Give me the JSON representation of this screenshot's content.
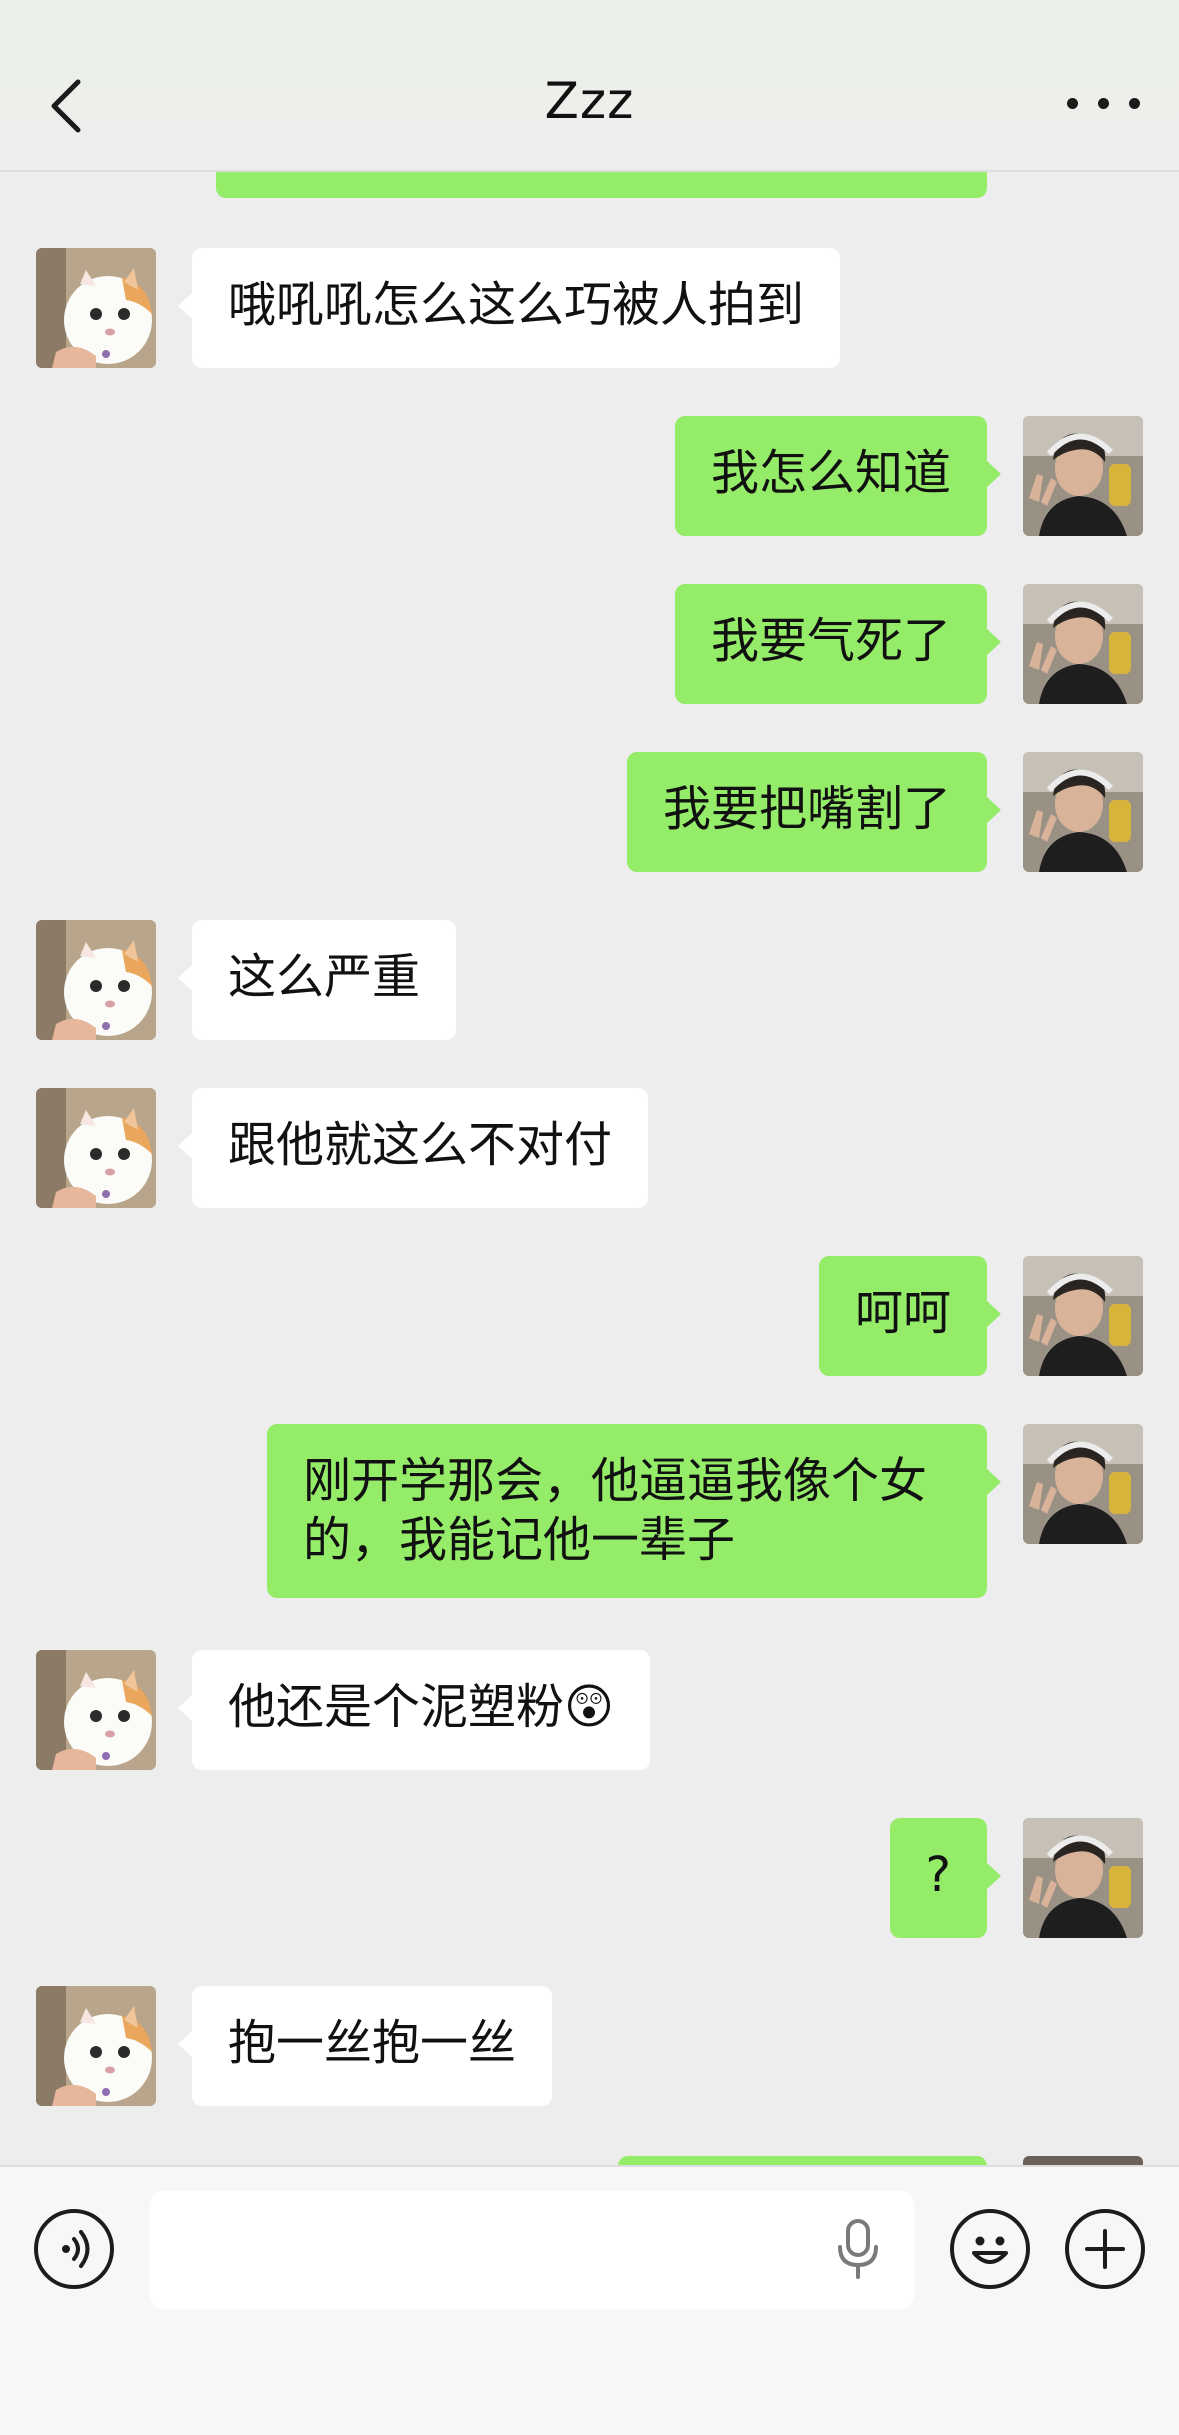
{
  "header": {
    "title": "Zzz",
    "back_icon": "chevron-left-icon",
    "more_icon": "more-dots-icon"
  },
  "colors": {
    "sent_bubble": "#95ec69",
    "received_bubble": "#ffffff",
    "background": "#ededed"
  },
  "messages": [
    {
      "side": "left",
      "text": "哦吼吼怎么这么巧被人拍到"
    },
    {
      "side": "right",
      "text": "我怎么知道"
    },
    {
      "side": "right",
      "text": "我要气死了"
    },
    {
      "side": "right",
      "text": "我要把嘴割了"
    },
    {
      "side": "left",
      "text": "这么严重"
    },
    {
      "side": "left",
      "text": "跟他就这么不对付"
    },
    {
      "side": "right",
      "text": "呵呵"
    },
    {
      "side": "right",
      "text": "刚开学那会，他逼逼我像个女的，我能记他一辈子"
    },
    {
      "side": "left",
      "text": "他还是个泥塑粉😲"
    },
    {
      "side": "right",
      "text": "?"
    },
    {
      "side": "left",
      "text": "抱一丝抱一丝"
    }
  ],
  "composer": {
    "input_value": "",
    "voice_icon": "voice-icon",
    "mic_icon": "microphone-icon",
    "emoji_icon": "emoji-icon",
    "plus_icon": "plus-icon"
  }
}
